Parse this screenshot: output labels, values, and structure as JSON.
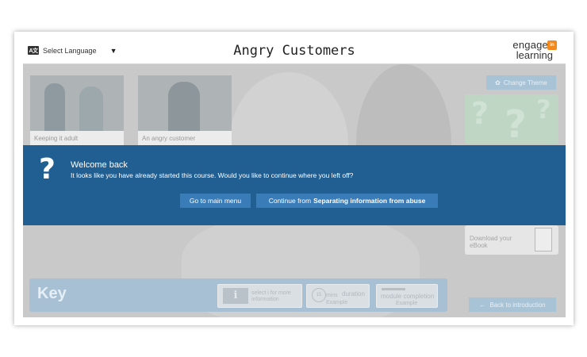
{
  "header": {
    "language_icon": "A文",
    "language_label": "Select Language",
    "language_caret": "▼",
    "title": "Angry Customers",
    "logo_top": "engage",
    "logo_bottom": "learning",
    "logo_badge": "in"
  },
  "stage": {
    "tiles": [
      {
        "label": "Keeping it adult"
      },
      {
        "label": "An angry customer"
      }
    ],
    "change_theme": "Change Theme",
    "ebook": {
      "label": "Download your eBook"
    },
    "key": {
      "title": "Key",
      "info_symbol": "i",
      "info_text": "select i for more information",
      "duration_clock": "15",
      "duration_unit": "mins",
      "duration_label": "duration",
      "duration_sub": "Example",
      "completion_label": "module completion",
      "completion_sub": "Example"
    },
    "back": "Back to introduction"
  },
  "banner": {
    "icon": "?",
    "title": "Welcome back",
    "message": "It looks like you have already started this course. Would you like to continue where you left off?",
    "main_menu_label": "Go to main menu",
    "continue_prefix": "Continue from",
    "continue_target": "Separating information from abuse"
  },
  "colors": {
    "banner": "#215f92",
    "button": "#3a7cb8",
    "logo_accent": "#f28a1e"
  }
}
